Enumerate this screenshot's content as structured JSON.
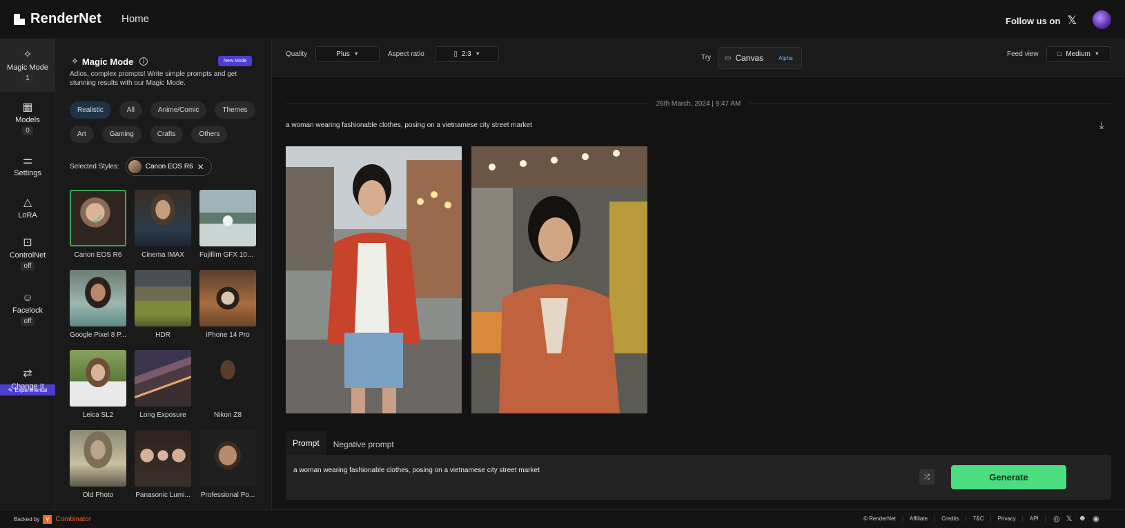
{
  "app": {
    "logo_text": "RenderNet",
    "nav_home": "Home",
    "follow_text": "Follow us on",
    "follow_icon": "x-logo-icon"
  },
  "rail": {
    "items": [
      {
        "label": "Magic Mode",
        "sub": "1",
        "icon": "magic-wand-icon",
        "active": true
      },
      {
        "label": "Models",
        "sub": "0",
        "icon": "grid-icon"
      },
      {
        "label": "Settings",
        "sub": "",
        "icon": "sliders-icon"
      },
      {
        "label": "LoRA",
        "sub": "",
        "icon": "shapes-icon"
      },
      {
        "label": "ControlNet",
        "sub": "off",
        "icon": "camera-focus-icon"
      },
      {
        "label": "Facelock",
        "sub": "off",
        "icon": "face-frame-icon"
      },
      {
        "label": "Change It",
        "sub": "",
        "icon": "swap-icon"
      }
    ],
    "experimental_label": "Experimental"
  },
  "panel": {
    "title": "Magic Mode",
    "new_mode_label": "New Mode",
    "description": "Adios, complex prompts! Write simple prompts and get stunning results with our Magic Mode.",
    "chips": [
      {
        "label": "Realistic",
        "selected": true
      },
      {
        "label": "All"
      },
      {
        "label": "Anime/Comic"
      },
      {
        "label": "Themes"
      },
      {
        "label": "Art"
      },
      {
        "label": "Gaming"
      },
      {
        "label": "Crafts"
      },
      {
        "label": "Others"
      }
    ],
    "selected_styles_label": "Selected Styles:",
    "selected_style": "Canon EOS R6",
    "styles": [
      {
        "label": "Canon EOS R6",
        "selected": true
      },
      {
        "label": "Cinema IMAX"
      },
      {
        "label": "Fujifilm GFX 100..."
      },
      {
        "label": "Google Pixel 8 P..."
      },
      {
        "label": "HDR"
      },
      {
        "label": "iPhone 14 Pro"
      },
      {
        "label": "Leica SL2"
      },
      {
        "label": "Long Exposure"
      },
      {
        "label": "Nikon Z8"
      },
      {
        "label": "Old Photo"
      },
      {
        "label": "Panasonic Lumi..."
      },
      {
        "label": "Professional Po..."
      }
    ]
  },
  "toolbar": {
    "quality_label": "Quality",
    "quality_value": "Plus",
    "aspect_label": "Aspect ratio",
    "aspect_value": "2:3",
    "try_label": "Try",
    "canvas_label": "Canvas",
    "alpha_label": "Alpha",
    "feed_label": "Feed view",
    "feed_value": "Medium"
  },
  "feed": {
    "date": "26th March, 2024 | 9:47 AM",
    "prompt": "a woman wearing fashionable clothes, posing on a vietnamese city street market"
  },
  "prompt_area": {
    "tab_prompt": "Prompt",
    "tab_negative": "Negative prompt",
    "text": "a woman wearing fashionable clothes, posing on a vietnamese city street market",
    "generate_label": "Generate"
  },
  "footer": {
    "backed_by": "Backed by",
    "yc_letter": "Y",
    "yc_name": "Combinator",
    "links": [
      "© RenderNet",
      "Affiliate",
      "Credits",
      "T&C",
      "Privacy",
      "API"
    ],
    "social_icons": [
      "instagram-icon",
      "x-logo-icon",
      "discord-icon",
      "reddit-icon"
    ]
  },
  "colors": {
    "accent_purple": "#4c3ed1",
    "generate_green": "#4ade80",
    "selected_chip": "#1f3347",
    "alpha_blue": "#6fb8ff"
  }
}
